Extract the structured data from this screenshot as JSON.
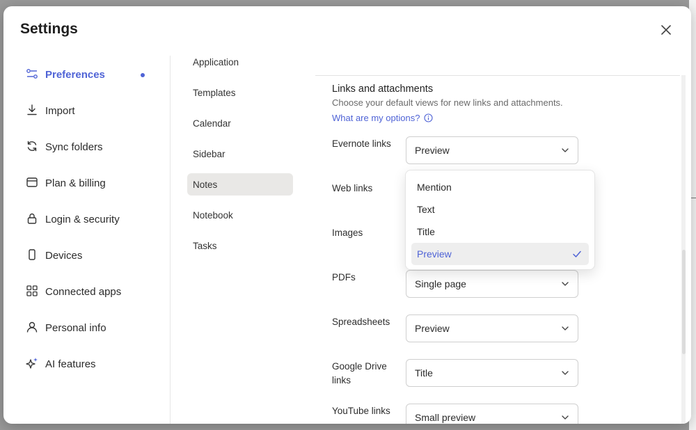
{
  "window": {
    "title": "Settings"
  },
  "colors": {
    "accent": "#4f63d6",
    "selected_bg": "#e9e8e6"
  },
  "nav": [
    {
      "label": "Preferences",
      "icon": "sliders-icon",
      "active": true
    },
    {
      "label": "Import",
      "icon": "download-icon"
    },
    {
      "label": "Sync folders",
      "icon": "sync-icon"
    },
    {
      "label": "Plan & billing",
      "icon": "billing-icon"
    },
    {
      "label": "Login & security",
      "icon": "lock-icon"
    },
    {
      "label": "Devices",
      "icon": "phone-icon"
    },
    {
      "label": "Connected apps",
      "icon": "apps-grid-icon"
    },
    {
      "label": "Personal info",
      "icon": "person-icon"
    },
    {
      "label": "AI features",
      "icon": "sparkle-icon"
    }
  ],
  "subnav": [
    {
      "label": "Application"
    },
    {
      "label": "Templates"
    },
    {
      "label": "Calendar"
    },
    {
      "label": "Sidebar"
    },
    {
      "label": "Notes",
      "active": true
    },
    {
      "label": "Notebook"
    },
    {
      "label": "Tasks"
    }
  ],
  "section": {
    "title": "Links and attachments",
    "description": "Choose your default views for new links and attachments.",
    "help_link": "What are my options?"
  },
  "settings": [
    {
      "label": "Evernote links",
      "value": "Preview"
    },
    {
      "label": "Web links",
      "value": ""
    },
    {
      "label": "Images",
      "value": ""
    },
    {
      "label": "PDFs",
      "value": "Single page"
    },
    {
      "label": "Spreadsheets",
      "value": "Preview"
    },
    {
      "label": "Google Drive links",
      "value": "Title"
    },
    {
      "label": "YouTube links",
      "value": "Small preview"
    }
  ],
  "dropdown": {
    "options": [
      "Mention",
      "Text",
      "Title",
      "Preview"
    ],
    "selected": "Preview"
  }
}
